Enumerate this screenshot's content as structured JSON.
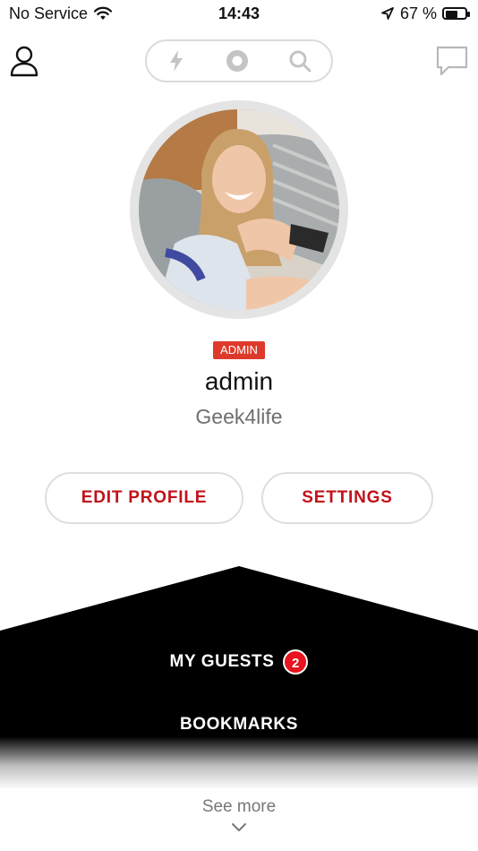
{
  "status_bar": {
    "carrier": "No Service",
    "time": "14:43",
    "battery_percent": "67 %",
    "battery_level": 0.67,
    "icons": [
      "wifi-icon",
      "location-arrow-icon",
      "battery-icon"
    ]
  },
  "top_nav": {
    "icons": [
      "user-profile-icon",
      "lightning-icon",
      "record-circle-icon",
      "search-icon",
      "chat-bubble-icon"
    ]
  },
  "profile": {
    "role_badge": "ADMIN",
    "username": "admin",
    "tagline": "Geek4life"
  },
  "actions": {
    "edit_profile": "EDIT PROFILE",
    "settings": "SETTINGS"
  },
  "menu": {
    "items": [
      {
        "label": "MY GUESTS",
        "badge": "2"
      },
      {
        "label": "BOOKMARKS"
      }
    ],
    "see_more": "See more"
  },
  "colors": {
    "accent_red": "#c1121a",
    "badge_red": "#de3a2b",
    "count_badge_red": "#e8141e",
    "menu_background": "#000000"
  }
}
